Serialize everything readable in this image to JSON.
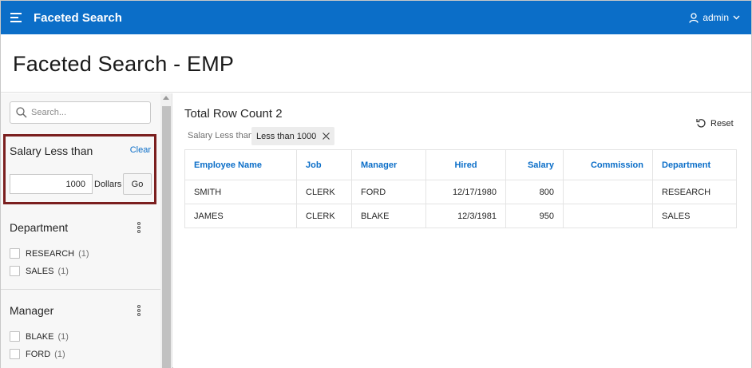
{
  "app": {
    "title": "Faceted Search",
    "user": "admin"
  },
  "page": {
    "title": "Faceted Search - EMP"
  },
  "sidebar": {
    "search": {
      "placeholder": "Search...",
      "value": ""
    },
    "salary_facet": {
      "title": "Salary Less than",
      "clear_label": "Clear",
      "value": "1000",
      "unit_label": "Dollars",
      "go_label": "Go"
    },
    "department_facet": {
      "title": "Department",
      "options": [
        {
          "label": "RESEARCH",
          "count": "(1)"
        },
        {
          "label": "SALES",
          "count": "(1)"
        }
      ]
    },
    "manager_facet": {
      "title": "Manager",
      "options": [
        {
          "label": "BLAKE",
          "count": "(1)"
        },
        {
          "label": "FORD",
          "count": "(1)"
        }
      ]
    }
  },
  "main": {
    "row_count_title": "Total Row Count 2",
    "reset_label": "Reset",
    "active_filter": {
      "label": "Salary Less than",
      "chip": "Less than 1000"
    },
    "table": {
      "columns": [
        "Employee Name",
        "Job",
        "Manager",
        "Hired",
        "Salary",
        "Commission",
        "Department"
      ],
      "rows": [
        [
          "SMITH",
          "CLERK",
          "FORD",
          "12/17/1980",
          "800",
          "",
          "RESEARCH"
        ],
        [
          "JAMES",
          "CLERK",
          "BLAKE",
          "12/3/1981",
          "950",
          "",
          "SALES"
        ]
      ]
    }
  },
  "colors": {
    "header_bg": "#0b6ec8",
    "link": "#0b6ec8",
    "highlight_border": "#7b1f1f"
  }
}
